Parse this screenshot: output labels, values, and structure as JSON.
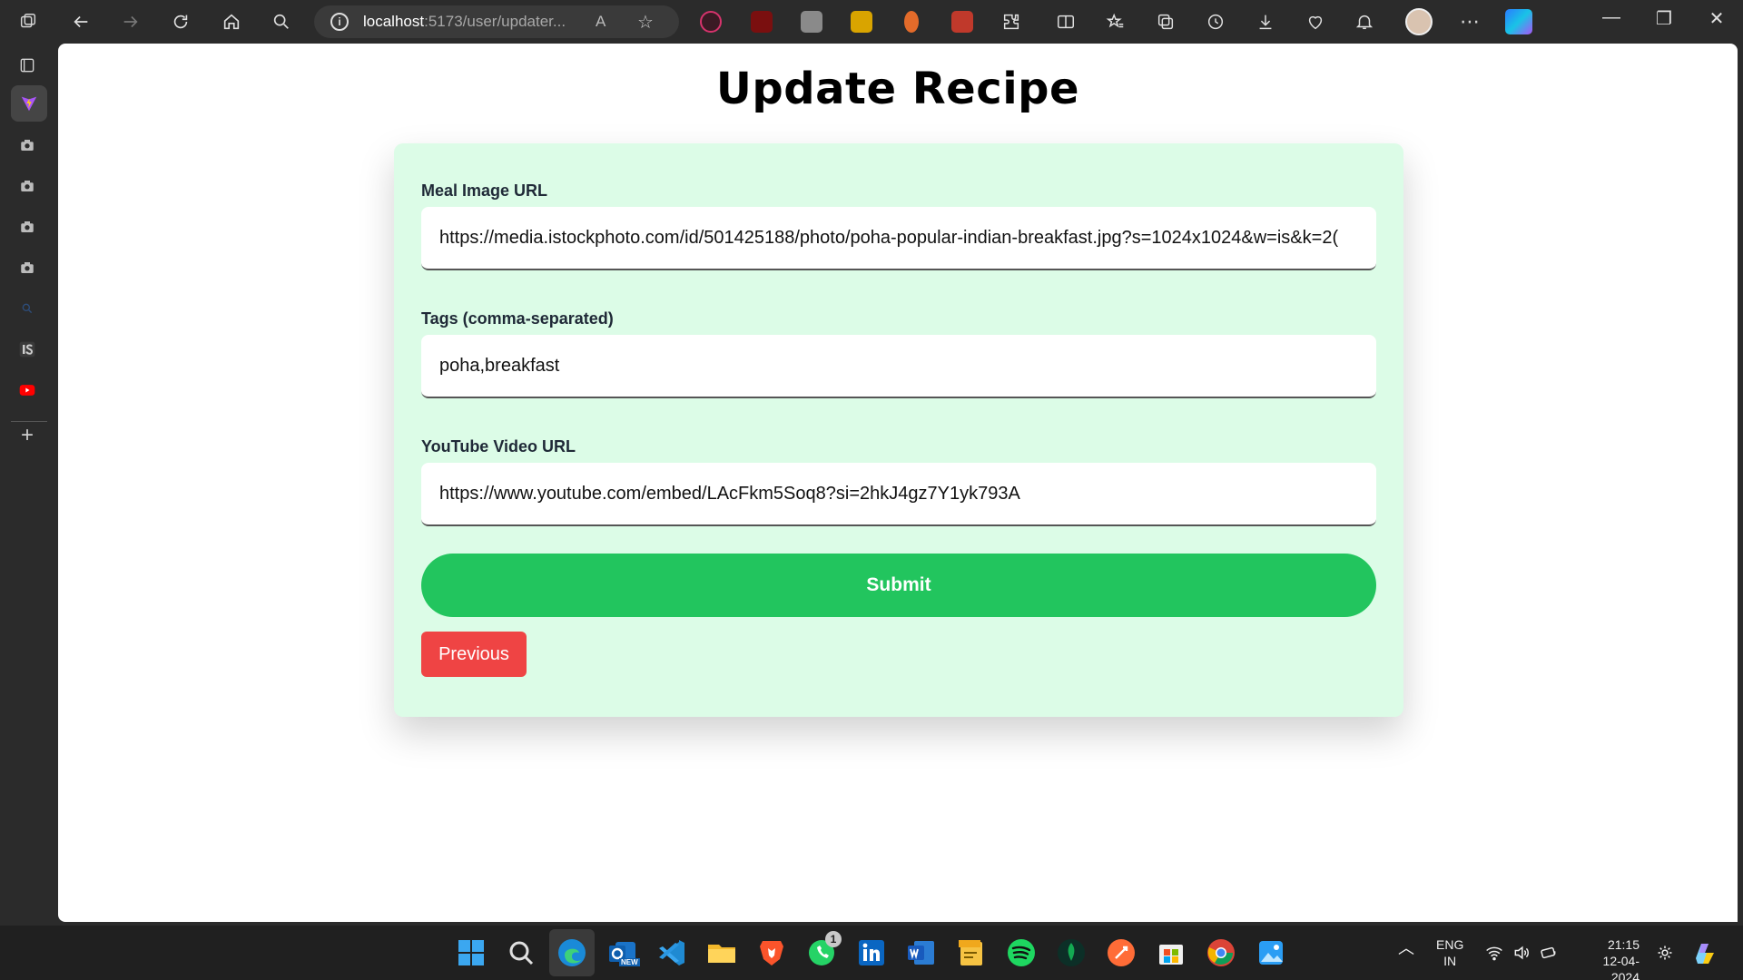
{
  "browser": {
    "url_host": "localhost",
    "url_rest": ":5173/user/updater...",
    "read_aloud_icon": "A",
    "window_controls": [
      "—",
      "❐",
      "✕"
    ]
  },
  "page": {
    "title": "Update Recipe",
    "form": {
      "image_label": "Meal Image URL",
      "image_value": "https://media.istockphoto.com/id/501425188/photo/poha-popular-indian-breakfast.jpg?s=1024x1024&w=is&k=2(",
      "tags_label": "Tags (comma-separated)",
      "tags_value": "poha,breakfast",
      "video_label": "YouTube Video URL",
      "video_value": "https://www.youtube.com/embed/LAcFkm5Soq8?si=2hkJ4gz7Y1yk793A",
      "submit_label": "Submit",
      "previous_label": "Previous"
    }
  },
  "taskbar": {
    "whatsapp_badge": "1",
    "outlook_badge": "NEW",
    "lang_line1": "ENG",
    "lang_line2": "IN",
    "time": "21:15",
    "date": "12-04-2024"
  },
  "colors": {
    "card_bg": "#dcfce7",
    "submit_bg": "#22c55e",
    "previous_bg": "#ef4444"
  }
}
